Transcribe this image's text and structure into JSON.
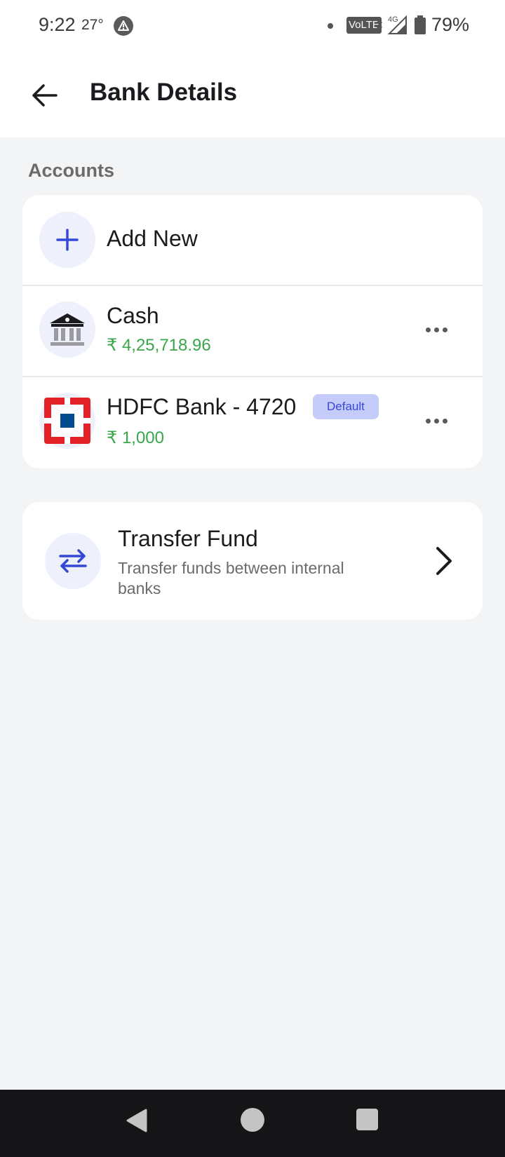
{
  "status_bar": {
    "time": "9:22",
    "temperature": "27°",
    "volte": "VoLTE",
    "network": "4G",
    "battery": "79%"
  },
  "header": {
    "title": "Bank Details",
    "back_icon": "arrow-left-icon"
  },
  "accounts": {
    "section_label": "Accounts",
    "add_new_label": "Add New",
    "items": [
      {
        "name": "Cash",
        "amount": "₹ 4,25,718.96",
        "icon": "bank-building-icon"
      },
      {
        "name": "HDFC Bank - 4720",
        "amount": "₹ 1,000",
        "badge": "Default",
        "icon": "hdfc-logo-icon"
      }
    ]
  },
  "transfer": {
    "title": "Transfer Fund",
    "description": "Transfer funds between internal banks",
    "icon": "swap-arrows-icon"
  },
  "colors": {
    "accent": "#3447d6",
    "amount_green": "#3aa64b",
    "badge_bg": "#c6ccfa",
    "hdfc_red": "#e42127",
    "hdfc_blue": "#004c8f"
  }
}
